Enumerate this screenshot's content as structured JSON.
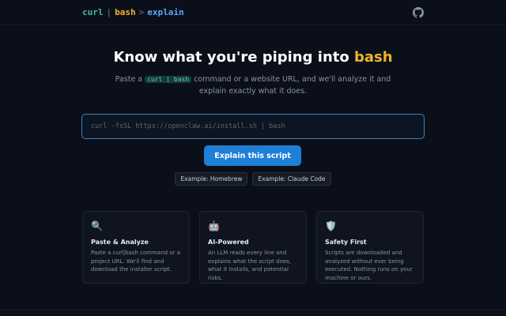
{
  "header": {
    "logo_curl": "curl",
    "logo_pipe": "|",
    "logo_bash": "bash",
    "logo_arrow": ">",
    "logo_explain": "explain",
    "github_icon": "github-icon"
  },
  "hero": {
    "title_main": "Know what you're piping into ",
    "title_accent": "bash",
    "subtitle_pre": "Paste a ",
    "subtitle_code": "curl | bash",
    "subtitle_post": " command or a website URL, and we'll analyze it and explain exactly what it does."
  },
  "input": {
    "placeholder": "curl -fsSL https://openclaw.ai/install.sh | bash",
    "value": ""
  },
  "primary_button": {
    "label": "Explain this script"
  },
  "examples": [
    {
      "label": "Example: Homebrew"
    },
    {
      "label": "Example: Claude Code"
    }
  ],
  "features": [
    {
      "icon": "🔍",
      "icon_name": "magnifier-icon",
      "title": "Paste & Analyze",
      "text": "Paste a curl|bash command or a project URL. We'll find and download the installer script."
    },
    {
      "icon": "🤖",
      "icon_name": "robot-icon",
      "title": "AI-Powered",
      "text": "An LLM reads every line and explains what the script does, what it installs, and potential risks."
    },
    {
      "icon": "🛡️",
      "icon_name": "shield-icon",
      "title": "Safety First",
      "text": "Scripts are downloaded and analyzed without ever being executed. Nothing runs on your machine or ours."
    }
  ],
  "colors": {
    "background": "#0b0f19",
    "accent_yellow": "#f0b429",
    "accent_teal": "#3fb9a5",
    "accent_blue": "#58a6ff",
    "button_blue": "#1f7fd6"
  }
}
